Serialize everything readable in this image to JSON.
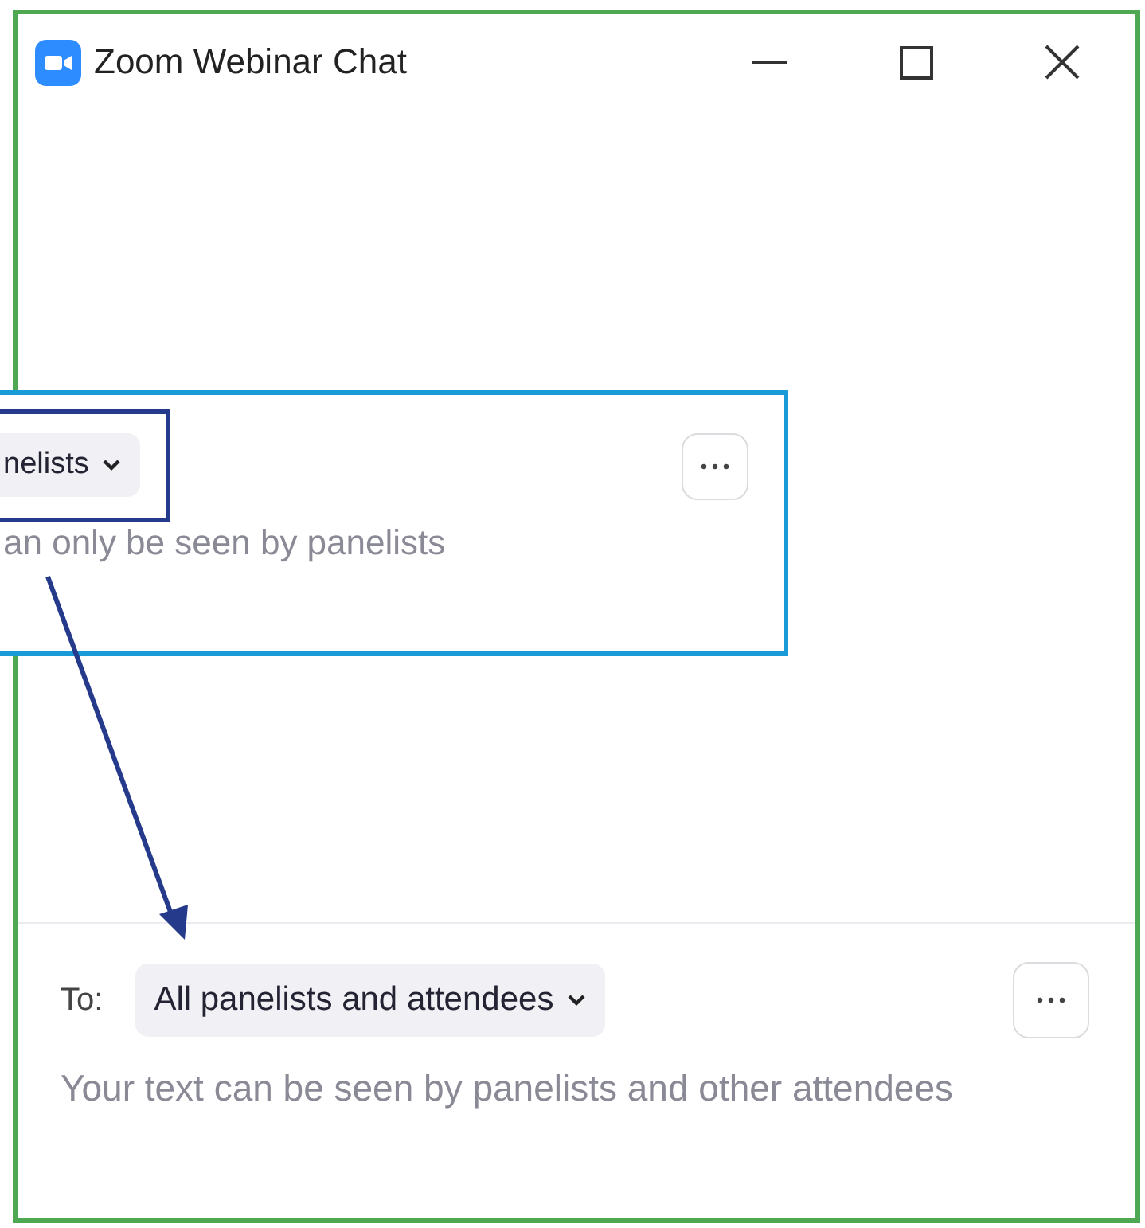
{
  "window": {
    "title": "Zoom Webinar Chat"
  },
  "inset": {
    "recipient_dropdown": "nelists",
    "hint": "an only be seen by panelists"
  },
  "composer": {
    "to_label": "To:",
    "recipient_dropdown": "All panelists and attendees",
    "placeholder": "Your text can be seen by panelists and other attendees"
  }
}
